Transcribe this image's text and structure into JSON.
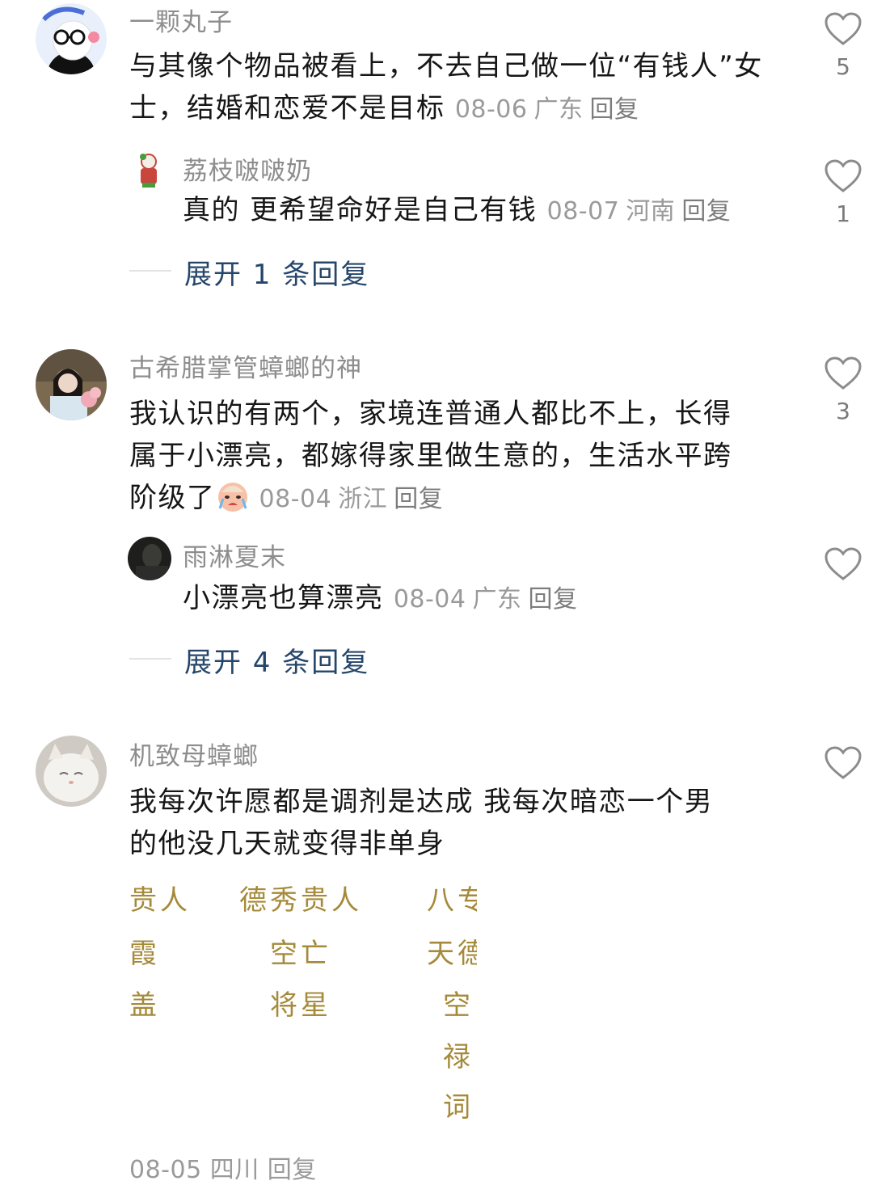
{
  "comments": [
    {
      "username": "一颗丸子",
      "text": "与其像个物品被看上，不去自己做一位“有钱人”女士，结婚和恋爱不是目标",
      "date": "08-06",
      "location": "广东",
      "reply_label": "回复",
      "likes": "5",
      "reply": {
        "username": "荔枝啵啵奶",
        "text": "真的 更希望命好是自己有钱",
        "date": "08-07",
        "location": "河南",
        "reply_label": "回复",
        "likes": "1"
      },
      "expand_label": "展开 1 条回复"
    },
    {
      "username": "古希腊掌管蟑螂的神",
      "text_line1": "我认识的有两个，家境连普通人都比不上，长得",
      "text_line2": "属于小漂亮，都嫁得家里做生意的，生活水平跨",
      "text_line3": "阶级了",
      "emoji": "crying-face-emoji",
      "date": "08-04",
      "location": "浙江",
      "reply_label": "回复",
      "likes": "3",
      "reply": {
        "username": "雨淋夏末",
        "text": "小漂亮也算漂亮",
        "date": "08-04",
        "location": "广东",
        "reply_label": "回复",
        "likes": ""
      },
      "expand_label": "展开 4 条回复"
    },
    {
      "username": "机致母蟑螂",
      "text_line1": "我每次许愿都是调剂是达成 我每次暗恋一个男",
      "text_line2": "的他没几天就变得非单身",
      "likes": "",
      "image_words": {
        "col1": [
          "贵人",
          "霞",
          "盖"
        ],
        "col2": [
          "德秀贵人",
          "空亡",
          "将星"
        ],
        "col3": [
          "八专",
          "天德",
          "空",
          "禄",
          "词"
        ]
      },
      "partial_footer": "08-05 四川 回复"
    }
  ],
  "colors": {
    "expand_link": "#25466b",
    "highlight_word": "#a58a3a",
    "username": "#8d8d8d",
    "meta": "#9a9a9a"
  }
}
